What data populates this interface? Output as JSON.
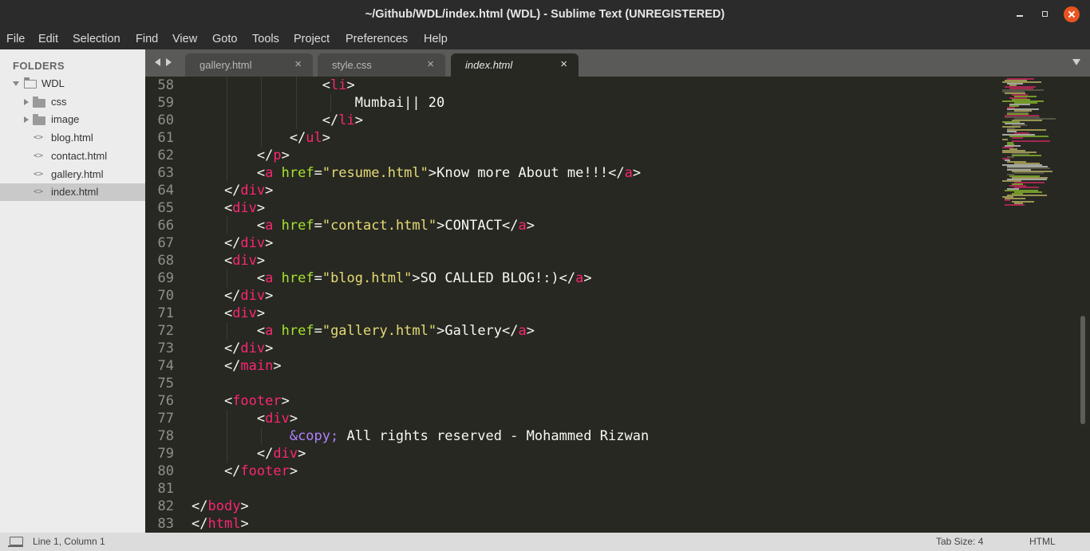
{
  "window": {
    "title": "~/Github/WDL/index.html (WDL) - Sublime Text (UNREGISTERED)"
  },
  "menu": [
    "File",
    "Edit",
    "Selection",
    "Find",
    "View",
    "Goto",
    "Tools",
    "Project",
    "Preferences",
    "Help"
  ],
  "sidebar": {
    "heading": "FOLDERS",
    "root": "WDL",
    "folders": [
      "css",
      "image"
    ],
    "files": [
      "blog.html",
      "contact.html",
      "gallery.html",
      "index.html"
    ],
    "selected": "index.html"
  },
  "tabs": [
    {
      "label": "gallery.html",
      "close": "×",
      "active": false
    },
    {
      "label": "style.css",
      "close": "×",
      "active": false
    },
    {
      "label": "index.html",
      "close": "×",
      "active": true
    }
  ],
  "editor": {
    "line_numbers": [
      "58",
      "59",
      "60",
      "61",
      "62",
      "63",
      "64",
      "65",
      "66",
      "67",
      "68",
      "69",
      "70",
      "71",
      "72",
      "73",
      "74",
      "75",
      "76",
      "77",
      "78",
      "79",
      "80",
      "81",
      "82",
      "83"
    ],
    "code_lines": [
      [
        [
          "t-p",
          "                <"
        ],
        [
          "t-tag",
          "li"
        ],
        [
          "t-p",
          ">"
        ]
      ],
      [
        [
          "t-txt",
          "                    Mumbai|| 20"
        ]
      ],
      [
        [
          "t-p",
          "                </"
        ],
        [
          "t-tag",
          "li"
        ],
        [
          "t-p",
          ">"
        ]
      ],
      [
        [
          "t-p",
          "            </"
        ],
        [
          "t-tag",
          "ul"
        ],
        [
          "t-p",
          ">"
        ]
      ],
      [
        [
          "t-p",
          "        </"
        ],
        [
          "t-tag",
          "p"
        ],
        [
          "t-p",
          ">"
        ]
      ],
      [
        [
          "t-p",
          "        <"
        ],
        [
          "t-tag",
          "a"
        ],
        [
          "t-p",
          " "
        ],
        [
          "t-attr",
          "href"
        ],
        [
          "t-p",
          "="
        ],
        [
          "t-str",
          "\"resume.html\""
        ],
        [
          "t-p",
          ">"
        ],
        [
          "t-txt",
          "Know more About me!!!"
        ],
        [
          "t-p",
          "</"
        ],
        [
          "t-tag",
          "a"
        ],
        [
          "t-p",
          ">"
        ]
      ],
      [
        [
          "t-p",
          "    </"
        ],
        [
          "t-tag",
          "div"
        ],
        [
          "t-p",
          ">"
        ]
      ],
      [
        [
          "t-p",
          "    <"
        ],
        [
          "t-tag",
          "div"
        ],
        [
          "t-p",
          ">"
        ]
      ],
      [
        [
          "t-p",
          "        <"
        ],
        [
          "t-tag",
          "a"
        ],
        [
          "t-p",
          " "
        ],
        [
          "t-attr",
          "href"
        ],
        [
          "t-p",
          "="
        ],
        [
          "t-str",
          "\"contact.html\""
        ],
        [
          "t-p",
          ">"
        ],
        [
          "t-txt",
          "CONTACT"
        ],
        [
          "t-p",
          "</"
        ],
        [
          "t-tag",
          "a"
        ],
        [
          "t-p",
          ">"
        ]
      ],
      [
        [
          "t-p",
          "    </"
        ],
        [
          "t-tag",
          "div"
        ],
        [
          "t-p",
          ">"
        ]
      ],
      [
        [
          "t-p",
          "    <"
        ],
        [
          "t-tag",
          "div"
        ],
        [
          "t-p",
          ">"
        ]
      ],
      [
        [
          "t-p",
          "        <"
        ],
        [
          "t-tag",
          "a"
        ],
        [
          "t-p",
          " "
        ],
        [
          "t-attr",
          "href"
        ],
        [
          "t-p",
          "="
        ],
        [
          "t-str",
          "\"blog.html\""
        ],
        [
          "t-p",
          ">"
        ],
        [
          "t-txt",
          "SO CALLED BLOG!:)"
        ],
        [
          "t-p",
          "</"
        ],
        [
          "t-tag",
          "a"
        ],
        [
          "t-p",
          ">"
        ]
      ],
      [
        [
          "t-p",
          "    </"
        ],
        [
          "t-tag",
          "div"
        ],
        [
          "t-p",
          ">"
        ]
      ],
      [
        [
          "t-p",
          "    <"
        ],
        [
          "t-tag",
          "div"
        ],
        [
          "t-p",
          ">"
        ]
      ],
      [
        [
          "t-p",
          "        <"
        ],
        [
          "t-tag",
          "a"
        ],
        [
          "t-p",
          " "
        ],
        [
          "t-attr",
          "href"
        ],
        [
          "t-p",
          "="
        ],
        [
          "t-str",
          "\"gallery.html\""
        ],
        [
          "t-p",
          ">"
        ],
        [
          "t-txt",
          "Gallery"
        ],
        [
          "t-p",
          "</"
        ],
        [
          "t-tag",
          "a"
        ],
        [
          "t-p",
          ">"
        ]
      ],
      [
        [
          "t-p",
          "    </"
        ],
        [
          "t-tag",
          "div"
        ],
        [
          "t-p",
          ">"
        ]
      ],
      [
        [
          "t-p",
          "    </"
        ],
        [
          "t-tag",
          "main"
        ],
        [
          "t-p",
          ">"
        ]
      ],
      [
        [
          "t-p",
          ""
        ]
      ],
      [
        [
          "t-p",
          "    <"
        ],
        [
          "t-tag",
          "footer"
        ],
        [
          "t-p",
          ">"
        ]
      ],
      [
        [
          "t-p",
          "        <"
        ],
        [
          "t-tag",
          "div"
        ],
        [
          "t-p",
          ">"
        ]
      ],
      [
        [
          "t-p",
          "            "
        ],
        [
          "t-ent",
          "&copy;"
        ],
        [
          "t-txt",
          " All rights reserved - Mohammed Rizwan"
        ]
      ],
      [
        [
          "t-p",
          "        </"
        ],
        [
          "t-tag",
          "div"
        ],
        [
          "t-p",
          ">"
        ]
      ],
      [
        [
          "t-p",
          "    </"
        ],
        [
          "t-tag",
          "footer"
        ],
        [
          "t-p",
          ">"
        ]
      ],
      [
        [
          "t-p",
          ""
        ]
      ],
      [
        [
          "t-p",
          "</"
        ],
        [
          "t-tag",
          "body"
        ],
        [
          "t-p",
          ">"
        ]
      ],
      [
        [
          "t-p",
          "</"
        ],
        [
          "t-tag",
          "html"
        ],
        [
          "t-p",
          ">"
        ]
      ]
    ]
  },
  "status": {
    "position": "Line 1, Column 1",
    "tab_size": "Tab Size: 4",
    "syntax": "HTML"
  },
  "colors": {
    "background": "#272822",
    "tag": "#f92672",
    "attribute": "#a6e22e",
    "string": "#e6db74",
    "entity": "#ae81ff",
    "text": "#f8f8f2",
    "gutter": "#8f908a"
  }
}
